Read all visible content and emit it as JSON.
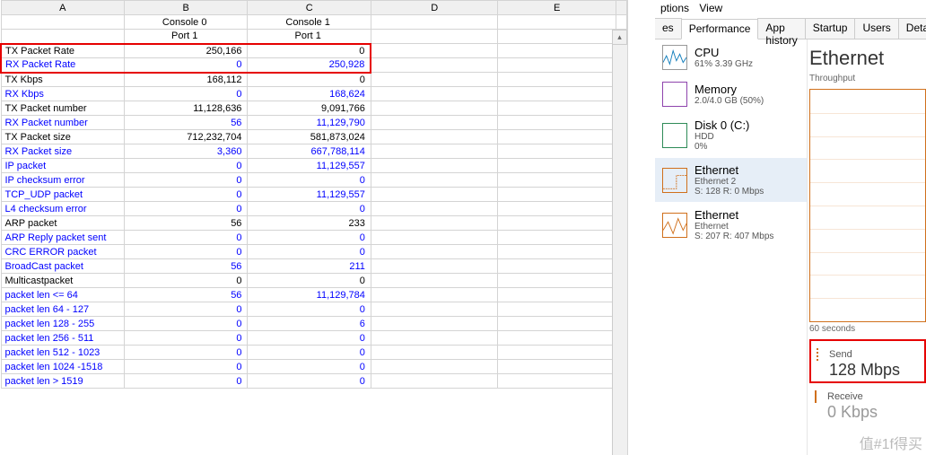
{
  "spreadsheet": {
    "columns": [
      "",
      "A",
      "B",
      "C",
      "D",
      "E",
      ""
    ],
    "header1": {
      "b": "Console 0",
      "c": "Console 1"
    },
    "header2": {
      "b": "Port 1",
      "c": "Port 1"
    },
    "rows": [
      {
        "label": "TX Packet Rate",
        "b": "250,166",
        "c": "0",
        "highlight": true,
        "blue": false
      },
      {
        "label": "RX Packet Rate",
        "b": "0",
        "c": "250,928",
        "highlight": true,
        "blue": true
      },
      {
        "label": "TX Kbps",
        "b": "168,112",
        "c": "0",
        "blue": false
      },
      {
        "label": "RX Kbps",
        "b": "0",
        "c": "168,624",
        "blue": true
      },
      {
        "label": "TX Packet number",
        "b": "11,128,636",
        "c": "9,091,766",
        "blue": false
      },
      {
        "label": "RX Packet number",
        "b": "56",
        "c": "11,129,790",
        "blue": true
      },
      {
        "label": "TX Packet size",
        "b": "712,232,704",
        "c": "581,873,024",
        "blue": false
      },
      {
        "label": "RX Packet size",
        "b": "3,360",
        "c": "667,788,114",
        "blue": true
      },
      {
        "label": "IP packet",
        "b": "0",
        "c": "11,129,557",
        "blue": true
      },
      {
        "label": "IP checksum error",
        "b": "0",
        "c": "0",
        "blue": true
      },
      {
        "label": "TCP_UDP packet",
        "b": "0",
        "c": "11,129,557",
        "blue": true
      },
      {
        "label": "L4 checksum error",
        "b": "0",
        "c": "0",
        "blue": true
      },
      {
        "label": "ARP packet",
        "b": "56",
        "c": "233",
        "blue": false
      },
      {
        "label": "ARP Reply packet sent",
        "b": "0",
        "c": "0",
        "blue": true
      },
      {
        "label": "CRC ERROR packet",
        "b": "0",
        "c": "0",
        "blue": true
      },
      {
        "label": "BroadCast packet",
        "b": "56",
        "c": "211",
        "blue": true
      },
      {
        "label": "Multicastpacket",
        "b": "0",
        "c": "0",
        "blue": false
      },
      {
        "label": "packet len <= 64",
        "b": "56",
        "c": "11,129,784",
        "blue": true
      },
      {
        "label": "packet len 64 - 127",
        "b": "0",
        "c": "0",
        "blue": true
      },
      {
        "label": "packet len 128 - 255",
        "b": "0",
        "c": "6",
        "blue": true
      },
      {
        "label": "packet len 256 - 511",
        "b": "0",
        "c": "0",
        "blue": true
      },
      {
        "label": "packet len 512 - 1023",
        "b": "0",
        "c": "0",
        "blue": true
      },
      {
        "label": "packet len 1024 -1518",
        "b": "0",
        "c": "0",
        "blue": true
      },
      {
        "label": "packet len > 1519",
        "b": "0",
        "c": "0",
        "blue": true
      }
    ]
  },
  "taskmgr": {
    "menu": {
      "ptions": "ptions",
      "view": "View"
    },
    "tabs": {
      "es": "es",
      "performance": "Performance",
      "apphistory": "App history",
      "startup": "Startup",
      "users": "Users",
      "details": "Details"
    },
    "sidebar": {
      "cpu": {
        "title": "CPU",
        "sub": "61% 3.39 GHz"
      },
      "memory": {
        "title": "Memory",
        "sub": "2.0/4.0 GB (50%)"
      },
      "disk": {
        "title": "Disk 0 (C:)",
        "sub1": "HDD",
        "sub2": "0%"
      },
      "eth1": {
        "title": "Ethernet",
        "sub1": "Ethernet 2",
        "sub2": "S: 128 R: 0 Mbps"
      },
      "eth2": {
        "title": "Ethernet",
        "sub1": "Ethernet",
        "sub2": "S: 207 R: 407 Mbps"
      }
    },
    "detail": {
      "title": "Ethernet",
      "sub": "Throughput",
      "axis60": "60 seconds",
      "send_label": "Send",
      "send_value": "128 Mbps",
      "recv_label": "Receive",
      "recv_value": "0 Kbps"
    }
  },
  "watermark": "值#1f得买"
}
